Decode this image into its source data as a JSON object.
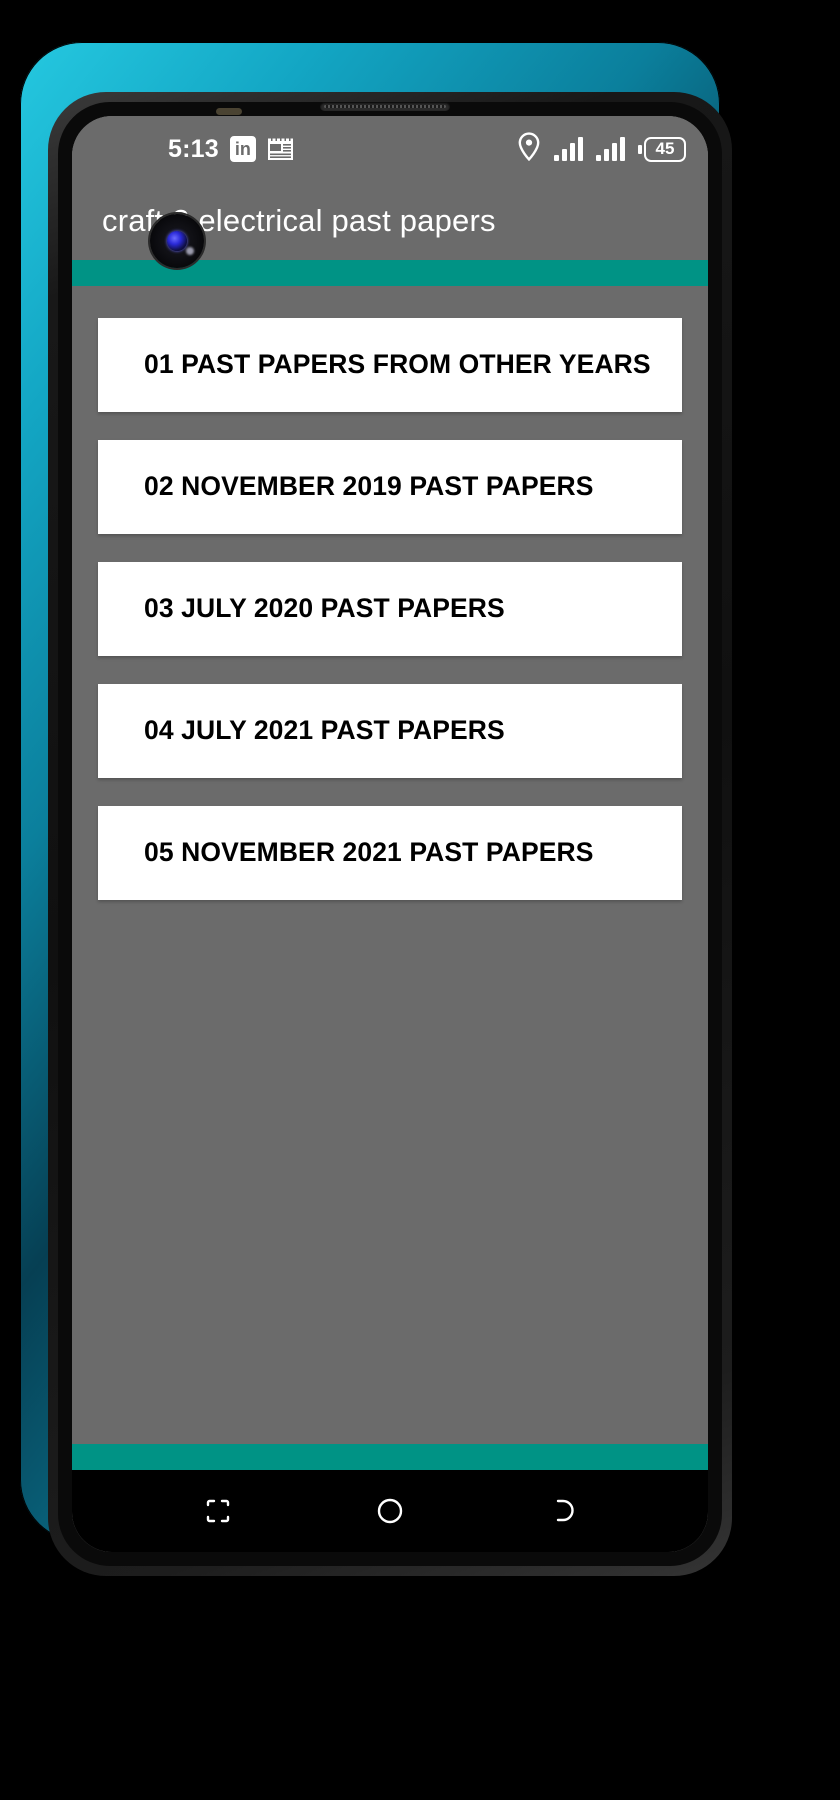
{
  "device": {
    "frame_color": "#17b4d2",
    "screen_bg": "#6b6b6b"
  },
  "status_bar": {
    "time": "5:13",
    "linkedin_label": "in",
    "icons_left": [
      "camera-punch-hole",
      "linkedin-icon",
      "news-icon"
    ],
    "icons_right": [
      "location-icon",
      "signal-icon-sim1",
      "signal-icon-sim2",
      "battery-icon"
    ],
    "battery_level": "45",
    "text_color": "#ffffff"
  },
  "app_bar": {
    "title": "craft 2 electrical past papers",
    "background": "#6b6b6b",
    "title_color": "#ffffff"
  },
  "accent": {
    "color": "#009385"
  },
  "list": {
    "items": [
      {
        "label": "01 PAST PAPERS FROM OTHER YEARS"
      },
      {
        "label": "02 NOVEMBER 2019 PAST PAPERS"
      },
      {
        "label": "03 JULY 2020 PAST PAPERS"
      },
      {
        "label": "04 JULY 2021 PAST PAPERS"
      },
      {
        "label": "05 NOVEMBER 2021 PAST PAPERS"
      }
    ],
    "card_background": "#ffffff",
    "card_text_color": "#000000"
  },
  "nav_bar": {
    "background": "#000000",
    "buttons": [
      {
        "name": "recents-button"
      },
      {
        "name": "home-button"
      },
      {
        "name": "back-button"
      }
    ]
  }
}
